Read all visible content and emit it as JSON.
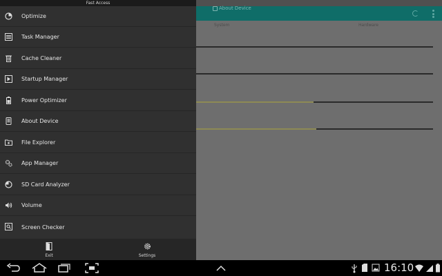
{
  "drawer": {
    "header_title": "Fast Access",
    "items": [
      {
        "label": "Optimize",
        "icon": "pie-chart-icon"
      },
      {
        "label": "Task Manager",
        "icon": "list-icon"
      },
      {
        "label": "Cache Cleaner",
        "icon": "trash-icon"
      },
      {
        "label": "Startup Manager",
        "icon": "play-icon"
      },
      {
        "label": "Power Optimizer",
        "icon": "battery-icon"
      },
      {
        "label": "About Device",
        "icon": "device-icon"
      },
      {
        "label": "File Explorer",
        "icon": "folder-icon"
      },
      {
        "label": "App Manager",
        "icon": "gears-icon"
      },
      {
        "label": "SD Card Analyzer",
        "icon": "sd-chart-icon"
      },
      {
        "label": "Volume",
        "icon": "volume-icon"
      },
      {
        "label": "Screen Checker",
        "icon": "screen-icon"
      }
    ],
    "footer": {
      "exit_label": "Exit",
      "settings_label": "Settings"
    }
  },
  "app": {
    "title": "About Device",
    "tabs": [
      "System",
      "Hardware"
    ]
  },
  "statusbar": {
    "time": "16:10"
  },
  "colors": {
    "drawer_bg": "#303030",
    "actionbar": "#0f6d68",
    "progress_fill": "#8d8a54"
  }
}
